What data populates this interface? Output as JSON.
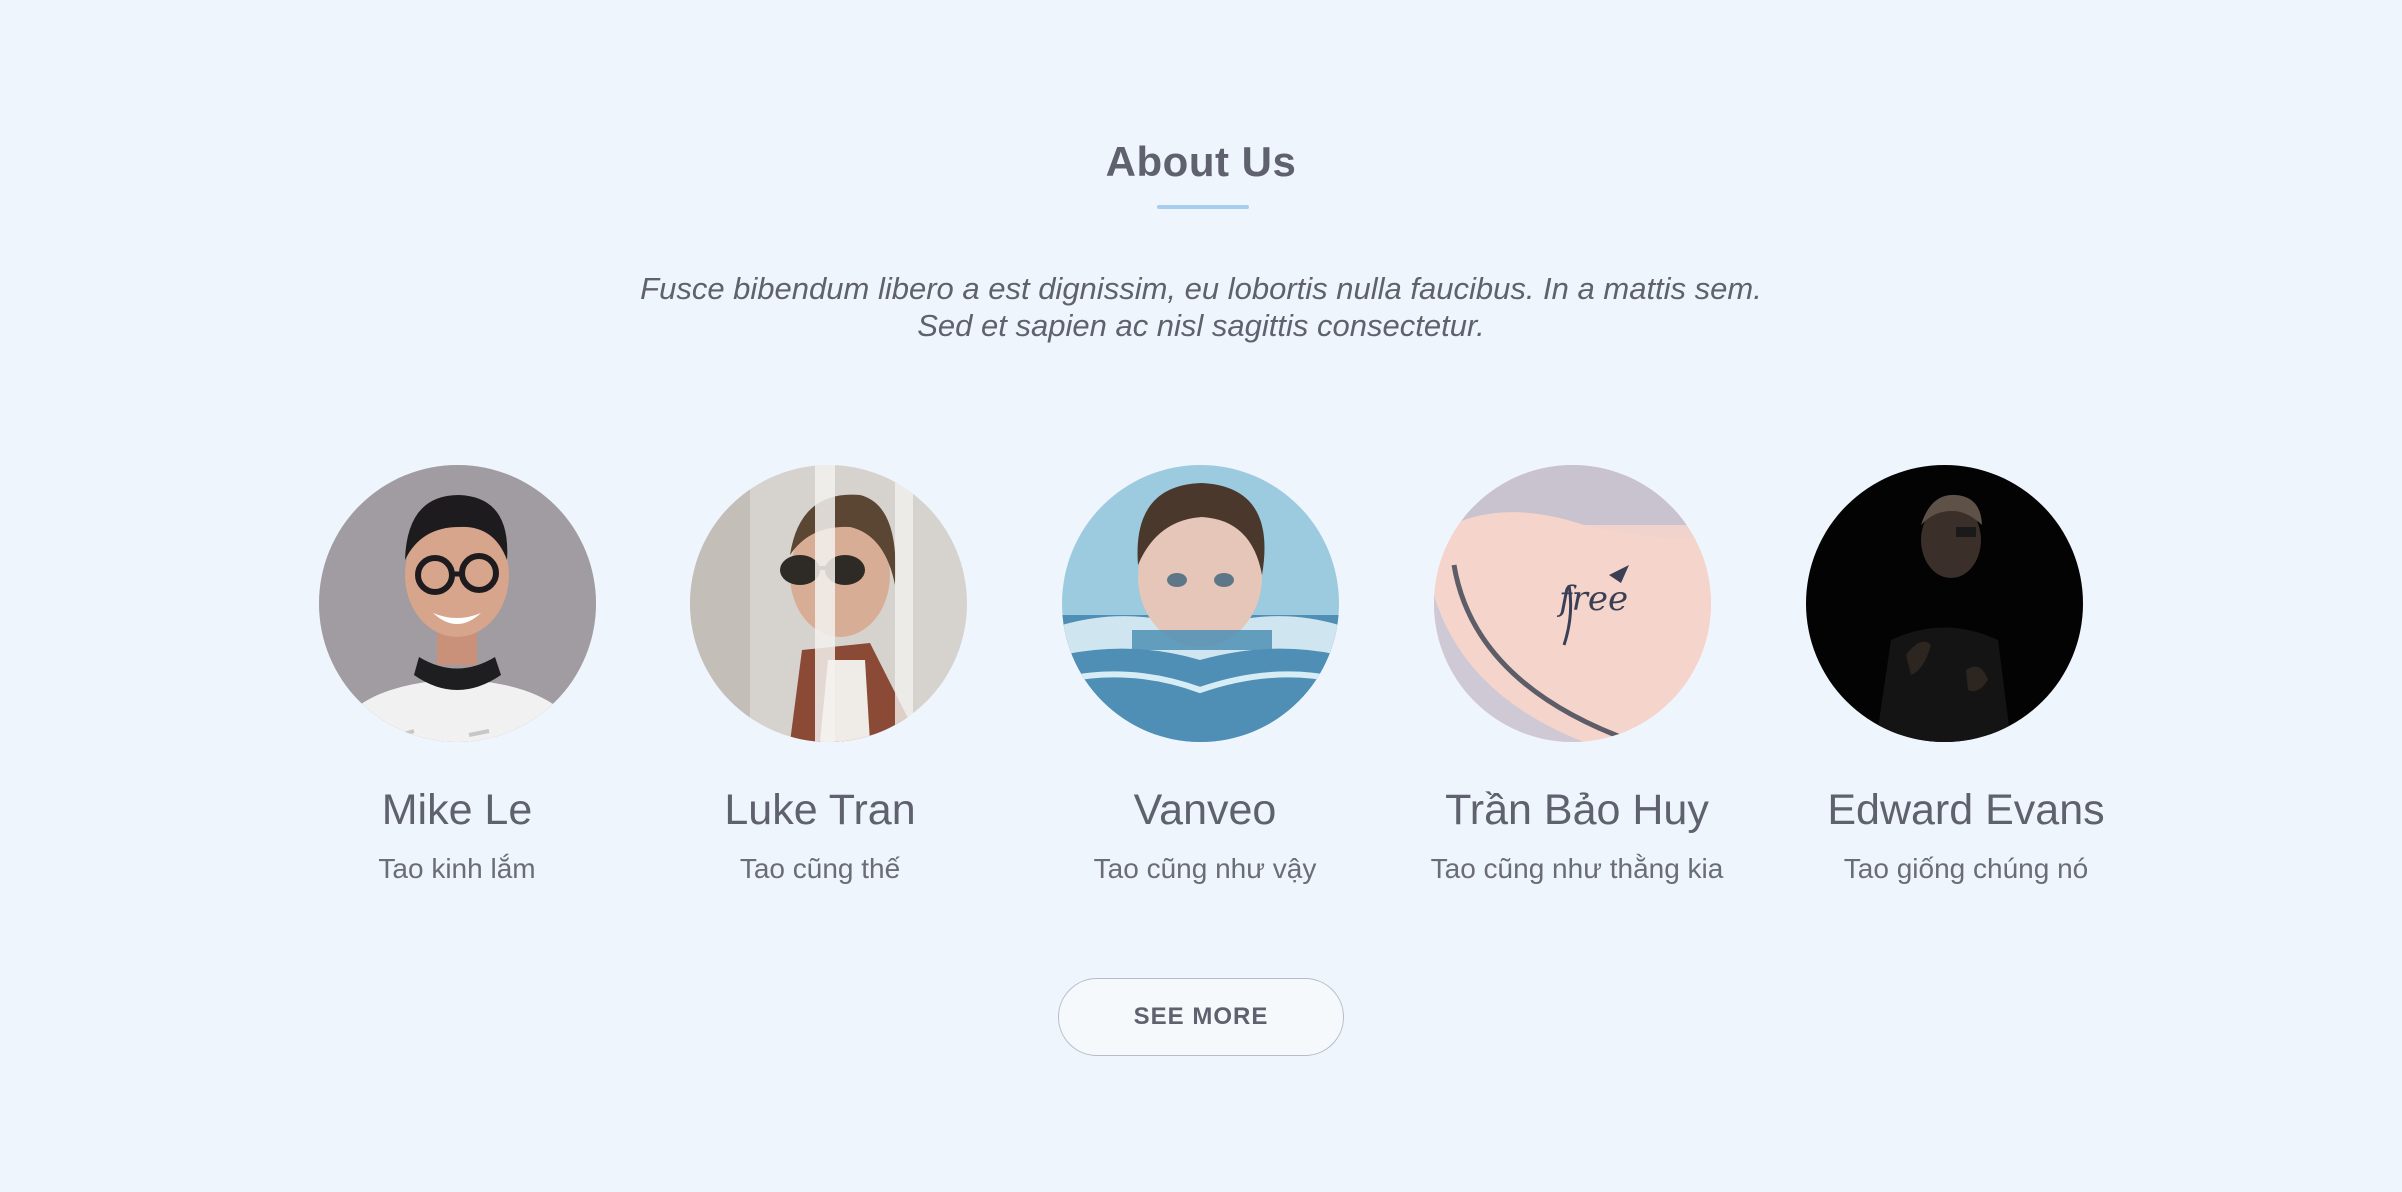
{
  "section": {
    "title": "About Us",
    "lede": "Fusce bibendum libero a est dignissim, eu lobortis nulla faucibus. In a mattis sem. Sed et sapien ac nisl sagittis consectetur.",
    "accent_color": "#a9cdef",
    "background_color": "#eff5fc"
  },
  "team": [
    {
      "name": "Mike Le",
      "role": "Tao kinh lắm",
      "photo": "man-with-glasses-smiling-photo"
    },
    {
      "name": "Luke Tran",
      "role": "Tao cũng thế",
      "photo": "man-with-sunglasses-photo"
    },
    {
      "name": "Vanveo",
      "role": "Tao cũng như vậy",
      "photo": "boy-in-water-photo"
    },
    {
      "name": "Trần Bảo Huy",
      "role": "Tao cũng như thằng kia",
      "photo": "shoulder-tattoo-photo"
    },
    {
      "name": "Edward Evans",
      "role": "Tao giống chúng nó",
      "photo": "man-in-dark-photo"
    }
  ],
  "actions": {
    "see_more_label": "SEE MORE"
  }
}
